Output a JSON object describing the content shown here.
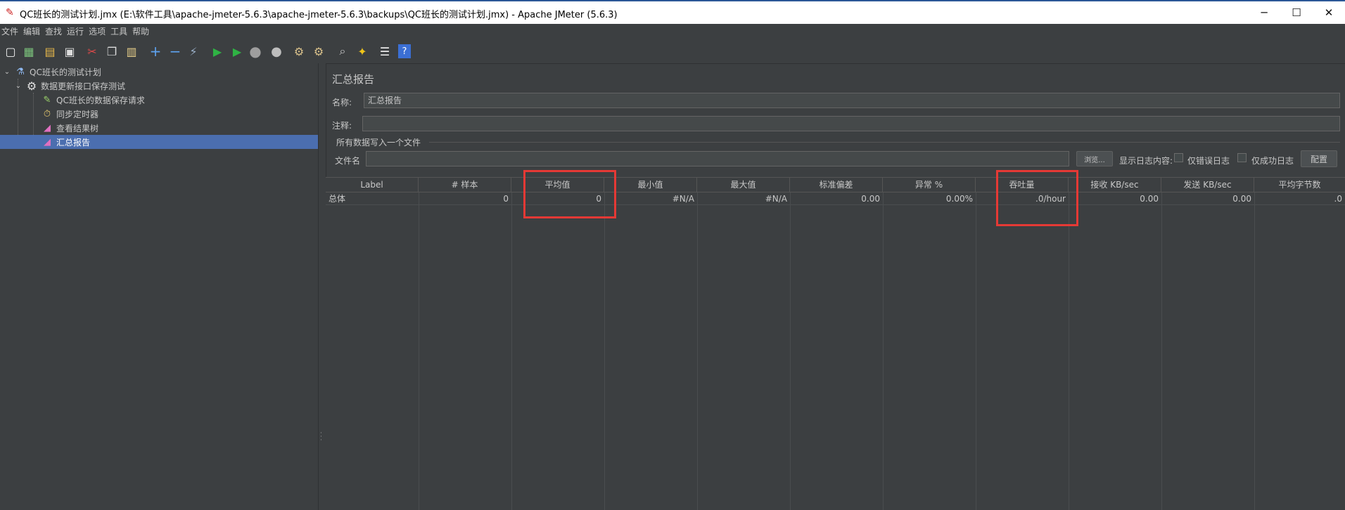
{
  "window": {
    "title": "QC班长的测试计划.jmx (E:\\软件工具\\apache-jmeter-5.6.3\\apache-jmeter-5.6.3\\backups\\QC班长的测试计划.jmx) - Apache JMeter (5.6.3)",
    "minimize": "─",
    "maximize": "☐",
    "close": "✕"
  },
  "menu": [
    "文件",
    "编辑",
    "查找",
    "运行",
    "选项",
    "工具",
    "帮助"
  ],
  "tree": {
    "root": "QC班长的测试计划",
    "thread_group": "数据更新接口保存测试",
    "children": [
      "QC班长的数据保存请求",
      "同步定时器",
      "查看结果树",
      "汇总报告"
    ]
  },
  "panel": {
    "title": "汇总报告",
    "name_label": "名称:",
    "name_value": "汇总报告",
    "comment_label": "注释:",
    "comment_value": "",
    "group_title": "所有数据写入一个文件",
    "filename_label": "文件名",
    "filename_value": "",
    "browse_button": "浏览...",
    "log_content_label": "显示日志内容:",
    "errors_only": "仅错误日志",
    "success_only": "仅成功日志",
    "configure_button": "配置"
  },
  "table": {
    "headers": [
      "Label",
      "# 样本",
      "平均值",
      "最小值",
      "最大值",
      "标准偏差",
      "异常 %",
      "吞吐量",
      "接收 KB/sec",
      "发送 KB/sec",
      "平均字节数"
    ],
    "rows": [
      [
        "总体",
        "0",
        "0",
        "#N/A",
        "#N/A",
        "0.00",
        "0.00%",
        ".0/hour",
        "0.00",
        "0.00",
        ".0"
      ]
    ]
  },
  "colors": {
    "background": "#3c3f41",
    "selection": "#4b6eaf",
    "highlight_box": "#e53935"
  }
}
